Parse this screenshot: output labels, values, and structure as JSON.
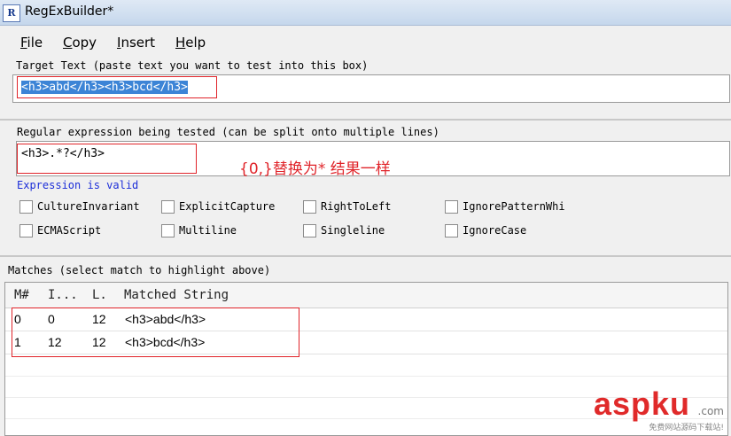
{
  "window": {
    "title": "RegExBuilder*",
    "icon_text": "R"
  },
  "menu": [
    {
      "label": "File",
      "accel": "F",
      "rest": "ile"
    },
    {
      "label": "Copy",
      "accel": "C",
      "rest": "opy"
    },
    {
      "label": "Insert",
      "accel": "I",
      "rest": "nsert"
    },
    {
      "label": "Help",
      "accel": "H",
      "rest": "elp"
    }
  ],
  "target": {
    "label": "Target Text (paste text you want to test into this box)",
    "value_part1": "<h3>abd</h3>",
    "value_part2": "<h3>bcd</h3>"
  },
  "regex": {
    "label": "Regular expression being tested (can be split onto multiple lines)",
    "value": "<h3>.*?</h3>",
    "annotation": "{0,}替换为* 结果一样",
    "status": "Expression is valid"
  },
  "options": [
    {
      "label": "CultureInvariant"
    },
    {
      "label": "ExplicitCapture"
    },
    {
      "label": "RightToLeft"
    },
    {
      "label": "IgnorePatternWhi"
    },
    {
      "label": "ECMAScript"
    },
    {
      "label": "Multiline"
    },
    {
      "label": "Singleline"
    },
    {
      "label": "IgnoreCase"
    }
  ],
  "matches": {
    "label": "Matches (select match to highlight above)",
    "columns": [
      "M#",
      "I...",
      "L.",
      "Matched String"
    ],
    "rows": [
      {
        "m": "0",
        "i": "0",
        "l": "12",
        "s": "<h3>abd</h3>"
      },
      {
        "m": "1",
        "i": "12",
        "l": "12",
        "s": "<h3>bcd</h3>"
      }
    ]
  },
  "watermark": {
    "main": "aspku",
    "suffix": ".com",
    "sub": "免费网站源码下载站!"
  },
  "colors": {
    "annotation_red": "#e0242a",
    "valid_blue": "#1c2ed8",
    "selection": "#3c84d6"
  }
}
